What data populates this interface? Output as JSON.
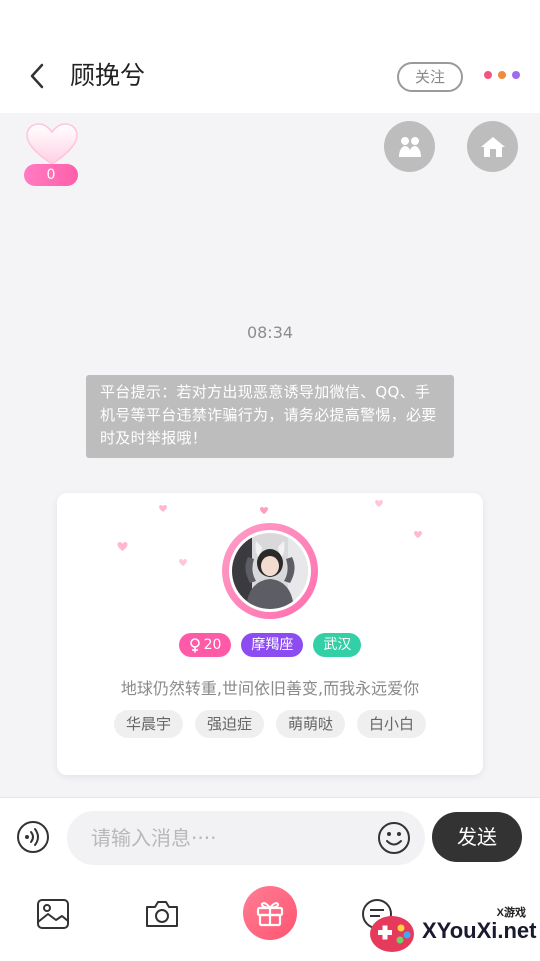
{
  "header": {
    "title": "顾挽兮",
    "follow_label": "关注",
    "more_dot_colors": [
      "#f2557f",
      "#f08a3c",
      "#9d6cf0"
    ]
  },
  "heart_widget": {
    "count": "0"
  },
  "chat": {
    "timestamp": "08:34",
    "notice": "平台提示：若对方出现恶意诱导加微信、QQ、手机号等平台违禁诈骗行为，请务必提高警惕，必要时及时举报哦！"
  },
  "profile_card": {
    "age": "20",
    "constellation": "摩羯座",
    "city": "武汉",
    "signature": "地球仍然转重,世间依旧善变,而我永远爱你",
    "tags": [
      "华晨宇",
      "强迫症",
      "萌萌哒",
      "白小白"
    ],
    "colors": {
      "age_pill": "#ff5aa8",
      "constellation_pill": "#8c4cf2",
      "city_pill": "#33cfa6"
    }
  },
  "input_bar": {
    "placeholder": "请输入消息····",
    "send_label": "发送"
  },
  "watermark": {
    "top": "X游戏",
    "main": "XYouXi.net"
  }
}
